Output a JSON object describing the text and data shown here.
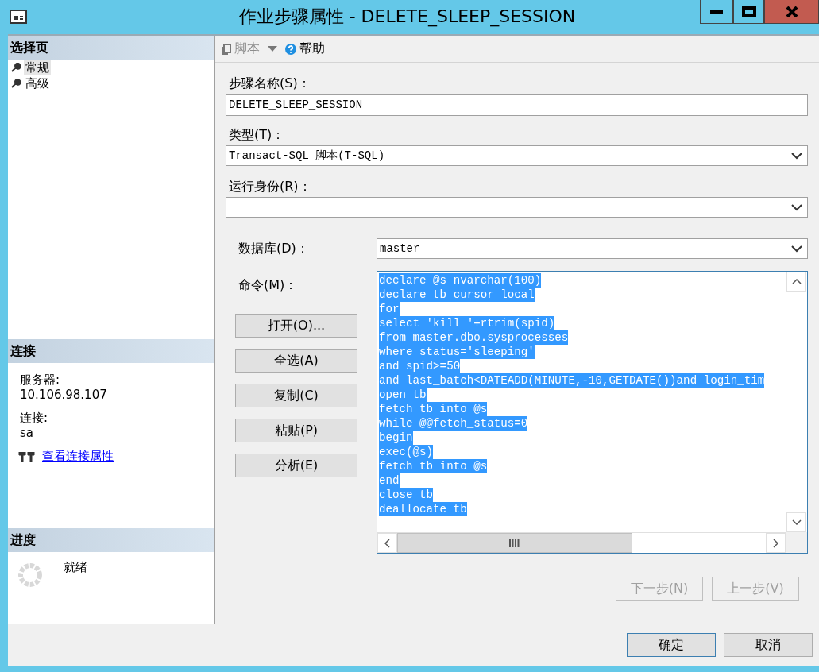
{
  "window": {
    "title": "作业步骤属性 - DELETE_SLEEP_SESSION"
  },
  "sidebar": {
    "pages_header": "选择页",
    "pages": [
      {
        "label": "常规",
        "selected": true
      },
      {
        "label": "高级",
        "selected": false
      }
    ],
    "connection_header": "连接",
    "connection": [
      {
        "label": "服务器:",
        "value": "10.106.98.107"
      },
      {
        "label": "连接:",
        "value": "sa"
      }
    ],
    "connection_link": "查看连接属性",
    "progress_header": "进度",
    "progress_status": "就绪"
  },
  "toolbar": {
    "script": {
      "label": "脚本",
      "disabled": true
    },
    "help": "帮助"
  },
  "form": {
    "step_name": {
      "label": "步骤名称(S)：",
      "value": "DELETE_SLEEP_SESSION"
    },
    "type": {
      "label": "类型(T)：",
      "value": "Transact-SQL 脚本(T-SQL)"
    },
    "run_as": {
      "label": "运行身份(R)："
    },
    "database": {
      "label": "数据库(D)：",
      "value": "master"
    },
    "command": {
      "label": "命令(M)：",
      "selected": true,
      "lines": [
        "declare @s nvarchar(100)",
        "declare tb cursor local",
        "for",
        "select 'kill '+rtrim(spid)",
        "from master.dbo.sysprocesses",
        "where status='sleeping'",
        "and spid>=50",
        "and last_batch<DATEADD(MINUTE,-10,GETDATE())and login_tim",
        "open tb",
        "fetch tb into @s",
        "while @@fetch_status=0",
        "begin",
        "exec(@s)",
        "fetch tb into @s",
        "end",
        "close tb",
        "deallocate tb"
      ]
    }
  },
  "command_buttons": [
    "打开(O)...",
    "全选(A)",
    "复制(C)",
    "粘贴(P)",
    "分析(E)"
  ],
  "nav_buttons": [
    {
      "label": "下一步(N)",
      "disabled": true
    },
    {
      "label": "上一步(V)",
      "disabled": true
    }
  ],
  "footer_buttons": [
    {
      "label": "确定",
      "default": true
    },
    {
      "label": "取消",
      "default": false
    }
  ]
}
